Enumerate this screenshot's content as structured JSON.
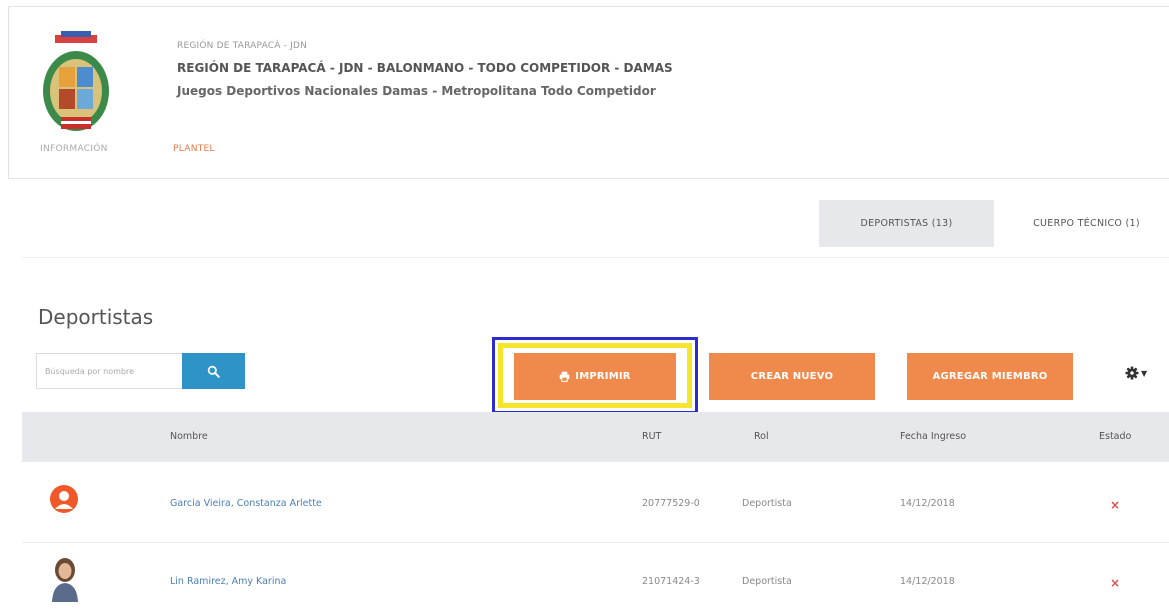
{
  "header": {
    "small_title": "REGIÓN DE TARAPACÁ - JDN",
    "title": "REGIÓN DE TARAPACÁ - JDN - BALONMANO - TODO COMPETIDOR - DAMAS",
    "subtitle": "Juegos Deportivos Nacionales Damas - Metropolitana Todo Competidor",
    "tabs": [
      {
        "label": "INFORMACIÓN",
        "active": false
      },
      {
        "label": "PLANTEL",
        "active": true
      }
    ]
  },
  "secondary_tabs": [
    {
      "label": "DEPORTISTAS (13)",
      "active": true
    },
    {
      "label": "CUERPO TÉCNICO (1)",
      "active": false
    }
  ],
  "section": {
    "title": "Deportistas",
    "search_placeholder": "Búsqueda por nombre",
    "buttons": {
      "print": "IMPRIMIR",
      "create": "CREAR NUEVO",
      "add_member": "AGREGAR MIEMBRO"
    }
  },
  "table": {
    "headers": {
      "nombre": "Nombre",
      "rut": "RUT",
      "rol": "Rol",
      "fecha": "Fecha Ingreso",
      "estado": "Estado"
    },
    "rows": [
      {
        "nombre": "Garcia Vieira, Constanza Arlette",
        "rut": "20777529-0",
        "rol": "Deportista",
        "fecha": "14/12/2018",
        "estado": "×"
      },
      {
        "nombre": "Lin Ramirez, Amy Karina",
        "rut": "21071424-3",
        "rol": "Deportista",
        "fecha": "14/12/2018",
        "estado": "×"
      }
    ]
  },
  "colors": {
    "accent": "#f08a4c",
    "search_button": "#2e93c6",
    "status_inactive": "#e34b4b",
    "highlight_outer": "#2c2bd0",
    "highlight_inner": "#f5e62b"
  }
}
